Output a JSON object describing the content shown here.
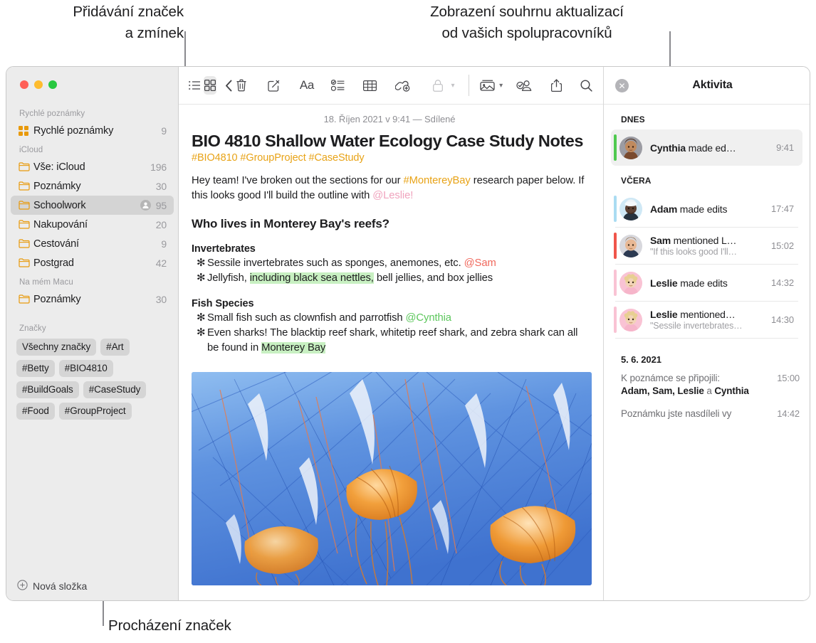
{
  "annotations": [
    {
      "id": "tags-mentions",
      "text": "Přidávání značek\na zmínek"
    },
    {
      "id": "activity-summary",
      "text": "Zobrazení souhrnu aktualizací\nod vašich spolupracovníků"
    },
    {
      "id": "browse-tags",
      "text": "Procházení značek"
    }
  ],
  "window": {
    "traffic_lights": {
      "close": "close-button",
      "minimize": "minimize-button",
      "zoom": "zoom-button"
    }
  },
  "sidebar": {
    "groups": [
      {
        "title": "Rychlé poznámky",
        "items": [
          {
            "label": "Rychlé poznámky",
            "count": "9",
            "icon": "quick-note-icon",
            "selected": false,
            "shared": false
          }
        ]
      },
      {
        "title": "iCloud",
        "items": [
          {
            "label": "Vše: iCloud",
            "count": "196",
            "icon": "folder-icon",
            "selected": false,
            "shared": false
          },
          {
            "label": "Poznámky",
            "count": "30",
            "icon": "folder-icon",
            "selected": false,
            "shared": false
          },
          {
            "label": "Schoolwork",
            "count": "95",
            "icon": "folder-icon",
            "selected": true,
            "shared": true
          },
          {
            "label": "Nakupování",
            "count": "20",
            "icon": "folder-icon",
            "selected": false,
            "shared": false
          },
          {
            "label": "Cestování",
            "count": "9",
            "icon": "folder-icon",
            "selected": false,
            "shared": false
          },
          {
            "label": "Postgrad",
            "count": "42",
            "icon": "folder-icon",
            "selected": false,
            "shared": false
          }
        ]
      },
      {
        "title": "Na mém Macu",
        "items": [
          {
            "label": "Poznámky",
            "count": "30",
            "icon": "folder-icon",
            "selected": false,
            "shared": false
          }
        ]
      }
    ],
    "tags_title": "Značky",
    "tags": [
      "Všechny značky",
      "#Art",
      "#Betty",
      "#BIO4810",
      "#BuildGoals",
      "#CaseStudy",
      "#Food",
      "#GroupProject"
    ],
    "new_folder_label": "Nová složka"
  },
  "toolbar": {
    "left": [
      {
        "name": "list-view-icon",
        "active": false
      },
      {
        "name": "gallery-view-icon",
        "active": true
      },
      {
        "name": "back-chevron-icon",
        "active": false
      }
    ],
    "right": [
      {
        "name": "trash-icon"
      },
      {
        "name": "compose-note-icon"
      },
      {
        "name": "format-aa-icon",
        "label": "Aa"
      },
      {
        "name": "checklist-icon"
      },
      {
        "name": "table-icon"
      },
      {
        "name": "add-link-icon"
      },
      {
        "name": "lock-icon",
        "disabled": true,
        "has_chevron": true
      },
      {
        "name": "media-icon",
        "has_chevron": true
      },
      {
        "name": "collaborate-icon"
      },
      {
        "name": "share-icon"
      },
      {
        "name": "search-icon"
      }
    ]
  },
  "note": {
    "date": "18. Říjen 2021 v 9:41 — Sdílené",
    "title": "BIO 4810 Shallow Water Ecology Case Study Notes",
    "tags": "#BIO4810 #GroupProject #CaseStudy",
    "intro": {
      "part1": "Hey team! I've broken out the sections for our ",
      "hashtag": "#MontereyBay",
      "part2": " research paper below. If this looks good I'll build the outline with ",
      "mention": "@Leslie!"
    },
    "heading": "Who lives in Monterey Bay's reefs?",
    "sections": [
      {
        "subheading": "Invertebrates",
        "bullets": [
          {
            "marker": "✻",
            "text": "Sessile invertebrates such as sponges, anemones, etc. ",
            "mention": "@Sam",
            "mention_color": "red"
          },
          {
            "marker": "✻",
            "pre": "Jellyfish, ",
            "highlight": "including black sea nettles,",
            "post": " bell jellies, and box jellies"
          }
        ]
      },
      {
        "subheading": "Fish Species",
        "bullets": [
          {
            "marker": "✻",
            "text": "Small fish such as clownfish and parrotfish ",
            "mention": "@Cynthia",
            "mention_color": "green"
          },
          {
            "marker": "✻",
            "pre": "Even sharks! The blacktip reef shark, whitetip reef shark, and zebra shark can all be found in ",
            "highlight": "Monterey Bay",
            "post": ""
          }
        ]
      }
    ],
    "image_alt": "jellyfish-photo"
  },
  "activity": {
    "title": "Aktivita",
    "close_icon": "close-activity-icon",
    "sections": [
      {
        "label": "DNES",
        "items": [
          {
            "actor": "Cynthia",
            "action": " made ed…",
            "time": "9:41",
            "quote": "",
            "bar_color": "#4fc94f",
            "avatar_color": "#9c9ca3",
            "avatar_glyph": "🧑🏽",
            "selected": true
          }
        ]
      },
      {
        "label": "VČERA",
        "items": [
          {
            "actor": "Adam",
            "action": " made edits",
            "time": "17:47",
            "quote": "",
            "bar_color": "#aadcf2",
            "avatar_color": "#cfe8f5",
            "avatar_glyph": "🧑🏿",
            "selected": false
          },
          {
            "actor": "Sam",
            "action": " mentioned L…",
            "time": "15:02",
            "quote": "\"If this looks good I'll…",
            "bar_color": "#f0554a",
            "avatar_color": "#d8d8dd",
            "avatar_glyph": "🧑",
            "selected": false
          },
          {
            "actor": "Leslie",
            "action": " made edits",
            "time": "14:32",
            "quote": "",
            "bar_color": "#f9c3d4",
            "avatar_color": "#f9c3d4",
            "avatar_glyph": "👱",
            "selected": false
          },
          {
            "actor": "Leslie",
            "action": " mentioned…",
            "time": "14:30",
            "quote": "\"Sessile invertebrates…",
            "bar_color": "#f9c3d4",
            "avatar_color": "#f9c3d4",
            "avatar_glyph": "👱",
            "selected": false
          }
        ]
      }
    ],
    "history_date": "5. 6. 2021",
    "history": [
      {
        "text_prefix": "K poznámce se připojili:",
        "text_names": "Adam, Sam, Leslie",
        "text_and": " a ",
        "text_last": "Cynthia",
        "time": "15:00"
      },
      {
        "text_prefix": "Poznámku jste nasdíleli vy",
        "text_names": "",
        "text_and": "",
        "text_last": "",
        "time": "14:42"
      }
    ]
  }
}
